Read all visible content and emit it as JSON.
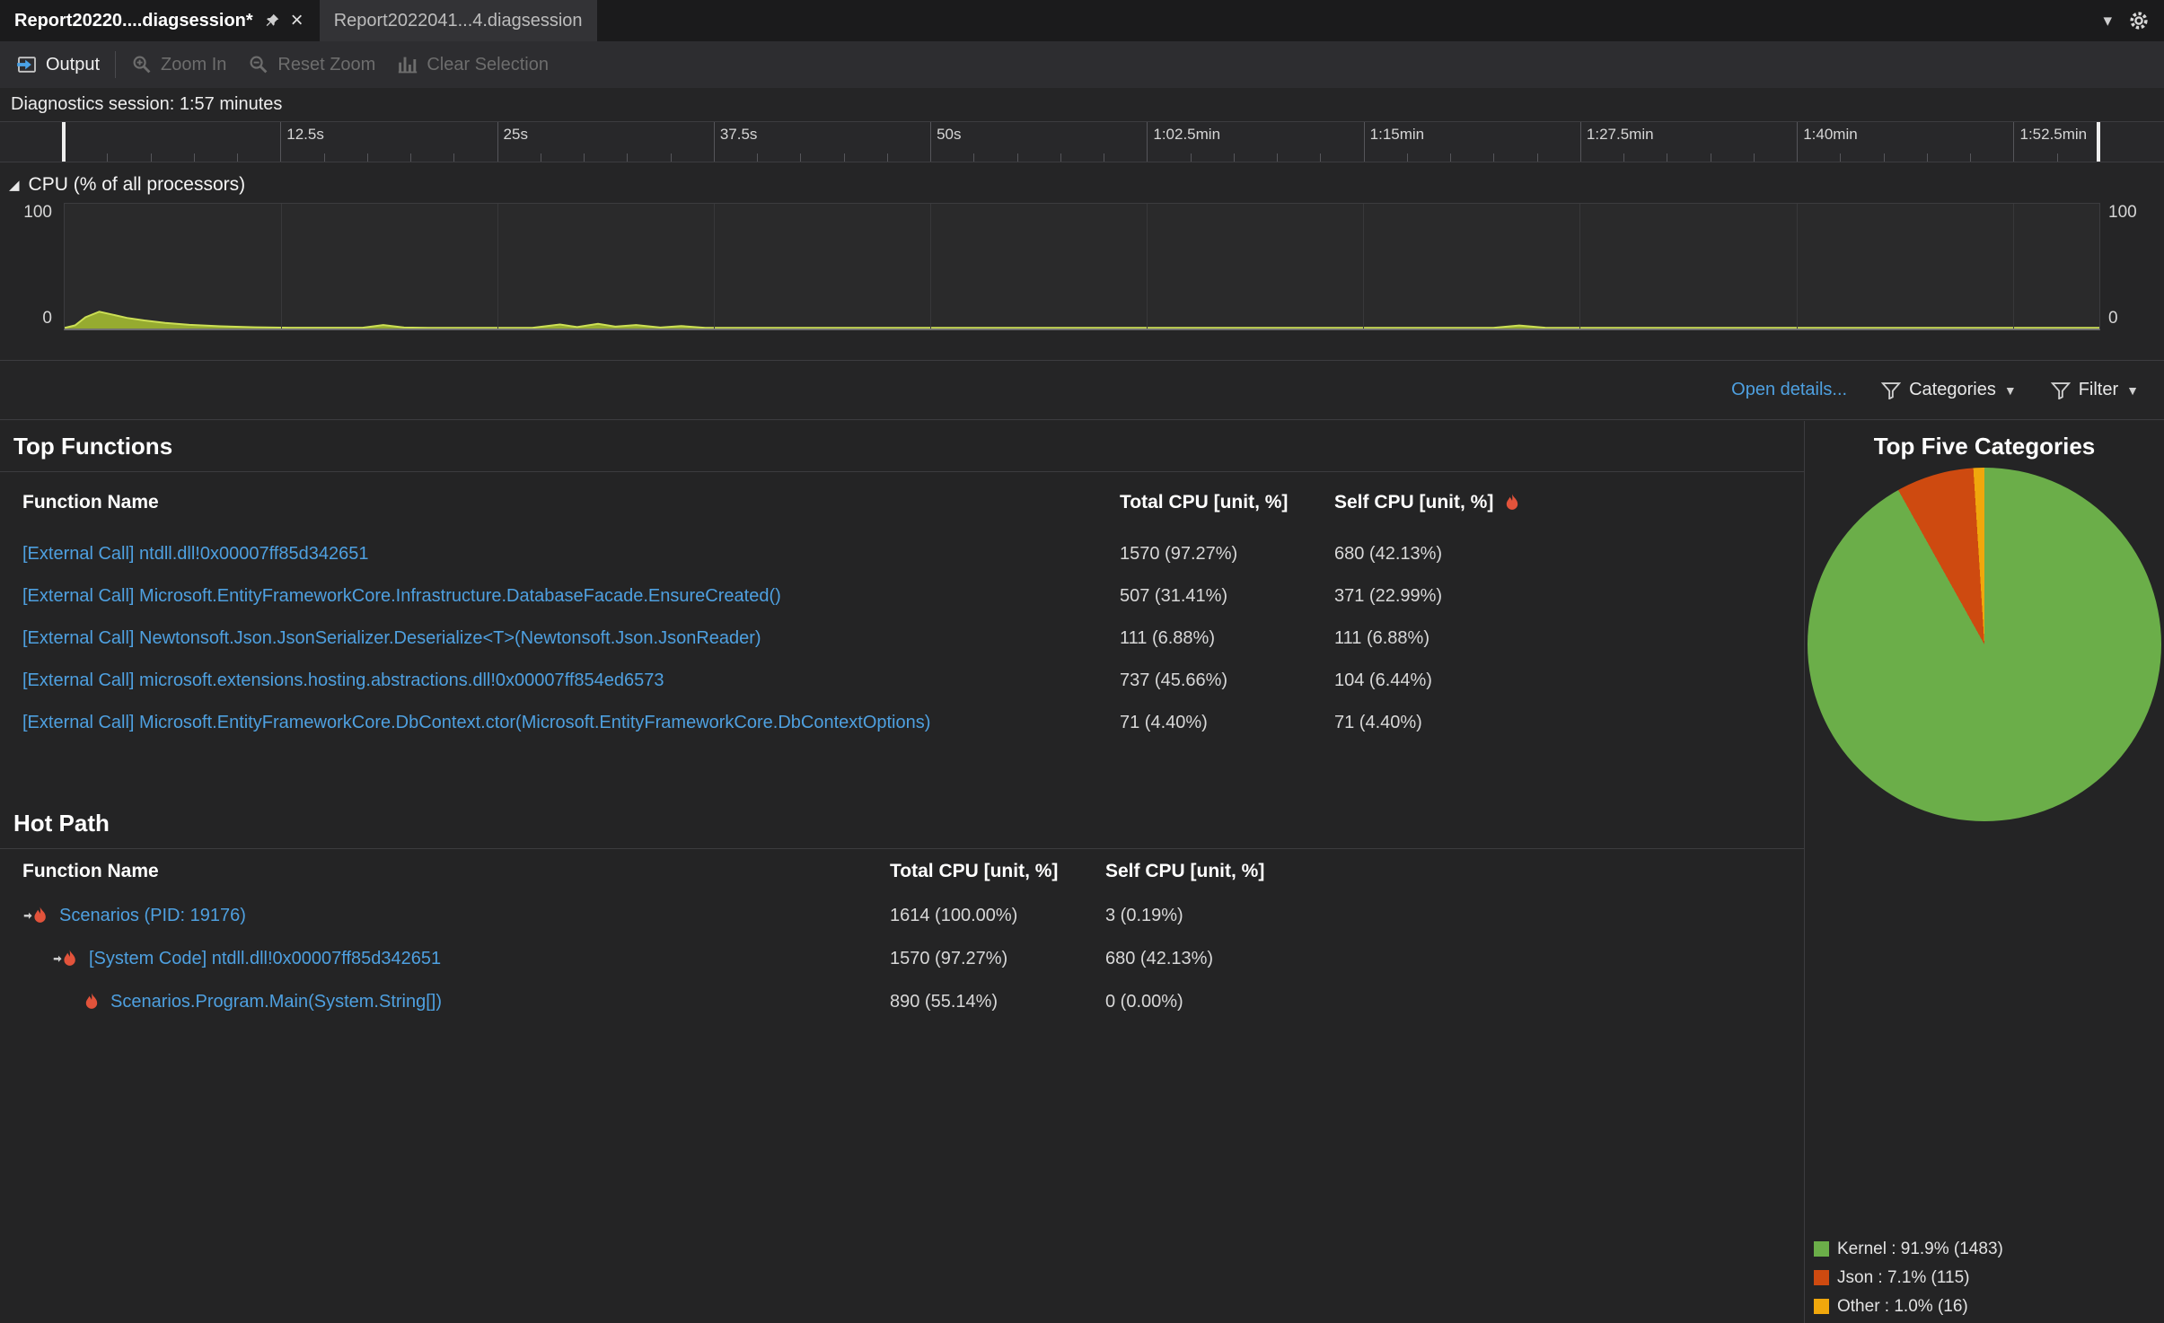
{
  "colors": {
    "link_blue": "#4ea0e0",
    "cpu_area_fill": "#a0b631",
    "cpu_area_line": "#ccdf55",
    "flame_red": "#e2533b"
  },
  "tab_bar": {
    "tabs": [
      {
        "label": "Report20220....diagsession*",
        "state": "active"
      },
      {
        "label": "Report2022041...4.diagsession",
        "state": "inactive"
      }
    ],
    "close_glyph": "×",
    "overflow_glyph": "▾"
  },
  "toolbar": {
    "output_label": "Output",
    "zoom_in_label": "Zoom In",
    "reset_zoom_label": "Reset Zoom",
    "clear_selection_label": "Clear Selection"
  },
  "session_bar": {
    "label": "Diagnostics session: 1:57 minutes"
  },
  "timeline": {
    "duration_s": 117.5,
    "minor_step_s": 2.5,
    "major_ticks": [
      {
        "s": 12.5,
        "label": "12.5s"
      },
      {
        "s": 25,
        "label": "25s"
      },
      {
        "s": 37.5,
        "label": "37.5s"
      },
      {
        "s": 50,
        "label": "50s"
      },
      {
        "s": 62.5,
        "label": "1:02.5min"
      },
      {
        "s": 75,
        "label": "1:15min"
      },
      {
        "s": 87.5,
        "label": "1:27.5min"
      },
      {
        "s": 100,
        "label": "1:40min"
      },
      {
        "s": 112.5,
        "label": "1:52.5min"
      }
    ]
  },
  "cpu_section": {
    "title": "CPU (% of all processors)",
    "y_top": "100",
    "y_bottom": "0"
  },
  "links_row": {
    "open_details": "Open details...",
    "categories": "Categories",
    "filter": "Filter"
  },
  "top_functions": {
    "title": "Top Functions",
    "columns": [
      "Function Name",
      "Total CPU [unit, %]",
      "Self CPU [unit, %]"
    ],
    "rows": [
      {
        "name": "[External Call] ntdll.dll!0x00007ff85d342651",
        "total": "1570 (97.27%)",
        "self": "680 (42.13%)"
      },
      {
        "name": "[External Call] Microsoft.EntityFrameworkCore.Infrastructure.DatabaseFacade.EnsureCreated()",
        "total": "507 (31.41%)",
        "self": "371 (22.99%)"
      },
      {
        "name": "[External Call] Newtonsoft.Json.JsonSerializer.Deserialize<T>(Newtonsoft.Json.JsonReader)",
        "total": "111 (6.88%)",
        "self": "111 (6.88%)"
      },
      {
        "name": "[External Call] microsoft.extensions.hosting.abstractions.dll!0x00007ff854ed6573",
        "total": "737 (45.66%)",
        "self": "104 (6.44%)"
      },
      {
        "name": "[External Call] Microsoft.EntityFrameworkCore.DbContext.ctor(Microsoft.EntityFrameworkCore.DbContextOptions)",
        "total": "71 (4.40%)",
        "self": "71 (4.40%)"
      }
    ]
  },
  "hot_path": {
    "title": "Hot Path",
    "columns": [
      "Function Name",
      "Total CPU [unit, %]",
      "Self CPU [unit, %]"
    ],
    "rows": [
      {
        "name": "Scenarios (PID: 19176)",
        "total": "1614 (100.00%)",
        "self": "3 (0.19%)",
        "indent": 0,
        "icon": "flame-arrow"
      },
      {
        "name": "[System Code] ntdll.dll!0x00007ff85d342651",
        "total": "1570 (97.27%)",
        "self": "680 (42.13%)",
        "indent": 1,
        "icon": "flame-arrow"
      },
      {
        "name": "Scenarios.Program.Main(System.String[])",
        "total": "890 (55.14%)",
        "self": "0 (0.00%)",
        "indent": 2,
        "icon": "flame"
      }
    ]
  },
  "categories_panel": {
    "title": "Top Five Categories",
    "legend": [
      {
        "label": "Kernel : 91.9% (1483)",
        "color": "#6bae49"
      },
      {
        "label": "Json : 7.1% (115)",
        "color": "#ce4a10"
      },
      {
        "label": "Other : 1.0% (16)",
        "color": "#f0a70c"
      }
    ]
  },
  "chart_data": [
    {
      "type": "area",
      "title": "CPU (% of all processors)",
      "ylabel": "% of all processors",
      "ylim": [
        0,
        100
      ],
      "xlim": [
        0,
        117.5
      ],
      "x_unit": "seconds",
      "grid": "vertical-major-ticks",
      "x": [
        0,
        0.6,
        1.2,
        2.0,
        2.8,
        3.6,
        4.6,
        5.8,
        7.2,
        9.0,
        11.0,
        13.0,
        17.2,
        18.4,
        19.6,
        21.0,
        27.0,
        28.6,
        29.6,
        30.8,
        31.8,
        33.0,
        34.4,
        35.6,
        37.0,
        44.0,
        82.5,
        84.0,
        85.5,
        87.0,
        100.0,
        117.5
      ],
      "y": [
        0.5,
        2.5,
        9.0,
        13.5,
        11.0,
        8.5,
        6.5,
        4.5,
        3.0,
        1.8,
        1.0,
        0.6,
        0.6,
        2.8,
        0.8,
        0.5,
        0.5,
        3.2,
        1.2,
        3.8,
        1.5,
        2.8,
        0.8,
        2.0,
        0.5,
        0.5,
        0.5,
        2.4,
        0.6,
        0.5,
        0.5,
        0.5
      ]
    },
    {
      "type": "pie",
      "title": "Top Five Categories",
      "labels": [
        "Kernel",
        "Json",
        "Other"
      ],
      "values": [
        91.9,
        7.1,
        1.0
      ],
      "counts": [
        1483,
        115,
        16
      ],
      "colors": [
        "#6bae49",
        "#ce4a10",
        "#f0a70c"
      ],
      "start_angle_deg": 0,
      "direction": "clockwise",
      "legend_position": "bottom-left"
    }
  ],
  "icons": {
    "output": "window-with-blue-arrow",
    "zoom_in": "magnifier-plus",
    "reset_zoom": "magnifier-minus",
    "clear_selection": "bar-chart",
    "pin": "pushpin",
    "close": "x",
    "tab_overflow": "chevron-down",
    "settings": "gear",
    "filter": "funnel",
    "hot_path_marker": "flame-arrow",
    "sort_indicator": "flame",
    "expander": "triangle"
  }
}
